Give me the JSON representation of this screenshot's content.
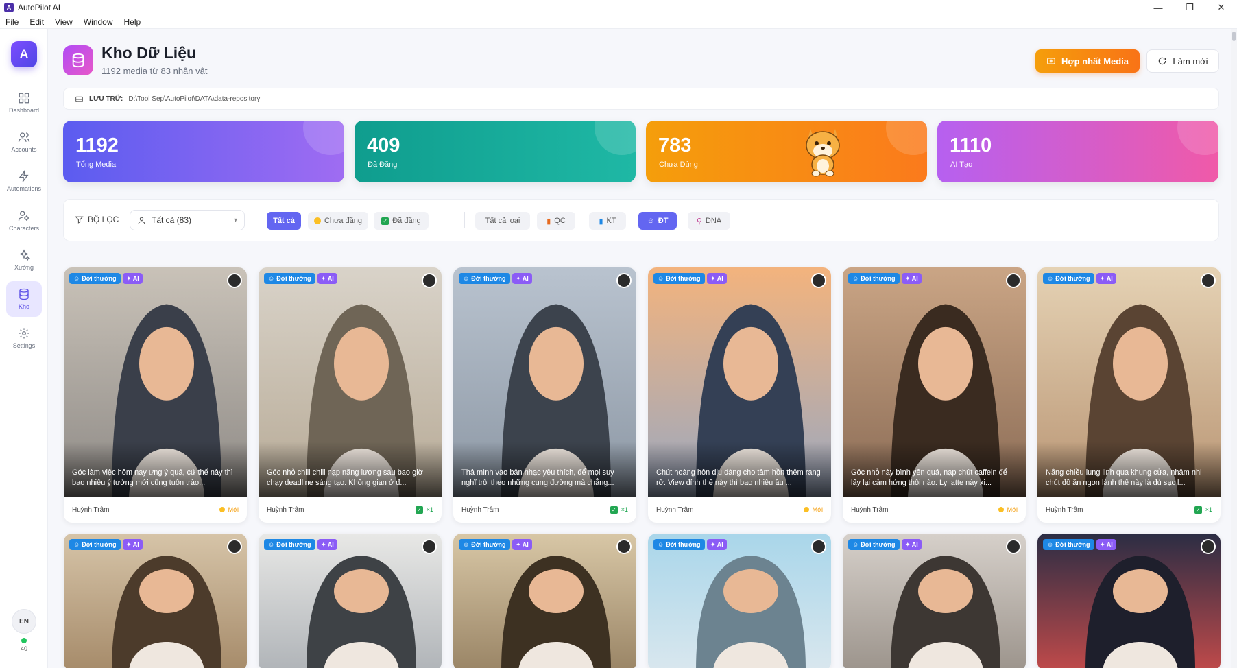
{
  "window": {
    "title": "AutoPilot AI",
    "minimize": "—",
    "maximize": "❐",
    "close": "✕"
  },
  "menu": [
    "File",
    "Edit",
    "View",
    "Window",
    "Help"
  ],
  "sidebar": {
    "logo": "A",
    "items": [
      {
        "label": "Dashboard",
        "icon": "grid-icon"
      },
      {
        "label": "Accounts",
        "icon": "users-icon"
      },
      {
        "label": "Automations",
        "icon": "bolt-icon"
      },
      {
        "label": "Characters",
        "icon": "characters-icon"
      },
      {
        "label": "Xưởng",
        "icon": "sparkles-icon"
      },
      {
        "label": "Kho",
        "icon": "database-icon",
        "active": true
      },
      {
        "label": "Settings",
        "icon": "gear-icon"
      }
    ],
    "language": "EN",
    "online_count": "40"
  },
  "header": {
    "title": "Kho Dữ Liệu",
    "subtitle": "1192 media từ 83 nhân vật",
    "merge_button": "Hợp nhất Media",
    "refresh_button": "Làm mới"
  },
  "storage": {
    "label": "LƯU TRỮ:",
    "path": "D:\\Tool Sep\\AutoPilot\\DATA\\data-repository"
  },
  "stats": [
    {
      "value": "1192",
      "caption": "Tổng Media"
    },
    {
      "value": "409",
      "caption": "Đã Đăng"
    },
    {
      "value": "783",
      "caption": "Chưa Dùng"
    },
    {
      "value": "1110",
      "caption": "AI Tạo"
    }
  ],
  "filters": {
    "label": "BỘ LỌC",
    "character_select": "Tất cả (83)",
    "status_chips": [
      "Tất cả",
      "Chưa đăng",
      "Đã đăng"
    ],
    "type_chips": [
      "Tất cả loại",
      "QC",
      "KT",
      "ĐT",
      "DNA"
    ],
    "active_status": "Tất cả",
    "active_type": "ĐT"
  },
  "colors": {
    "accent": "#6366f1",
    "orange": "#f97316",
    "teal": "#0f9d8e",
    "pink": "#f05aa8"
  },
  "media": [
    {
      "badge": "Đời thường",
      "ai": "AI",
      "caption": "Góc làm việc hôm nay ưng ý quá, cứ thế này thì bao nhiêu ý tưởng mới cũng tuôn trào...",
      "author": "Huỳnh Trâm",
      "status": "Mới",
      "published": false
    },
    {
      "badge": "Đời thường",
      "ai": "AI",
      "caption": "Góc nhỏ chill chill nạp năng lượng sau bao giờ chạy deadline sáng tạo. Không gian ở đ...",
      "author": "Huỳnh Trâm",
      "status": "×1",
      "published": true
    },
    {
      "badge": "Đời thường",
      "ai": "AI",
      "caption": "Thả mình vào bản nhạc yêu thích, để mọi suy nghĩ trôi theo những cung đường mà chẳng...",
      "author": "Huỳnh Trâm",
      "status": "×1",
      "published": true
    },
    {
      "badge": "Đời thường",
      "ai": "AI",
      "caption": "Chút hoàng hôn dịu dàng cho tâm hồn thêm rạng rỡ. View đỉnh thế này thì bao nhiêu âu ...",
      "author": "Huỳnh Trâm",
      "status": "Mới",
      "published": false
    },
    {
      "badge": "Đời thường",
      "ai": "AI",
      "caption": "Góc nhỏ này bình yên quá, nạp chút caffein để lấy lại cảm hứng thôi nào. Ly latte này xi...",
      "author": "Huỳnh Trâm",
      "status": "Mới",
      "published": false
    },
    {
      "badge": "Đời thường",
      "ai": "AI",
      "caption": "Nắng chiều lung linh qua khung cửa, nhâm nhi chút đồ ăn ngon lành thế này là đủ sạc l...",
      "author": "Huỳnh Trâm",
      "status": "×1",
      "published": true
    },
    {
      "badge": "Đời thường",
      "ai": "AI"
    },
    {
      "badge": "Đời thường",
      "ai": "AI"
    },
    {
      "badge": "Đời thường",
      "ai": "AI"
    },
    {
      "badge": "Đời thường",
      "ai": "AI"
    },
    {
      "badge": "Đời thường",
      "ai": "AI"
    },
    {
      "badge": "Đời thường",
      "ai": "AI"
    }
  ]
}
